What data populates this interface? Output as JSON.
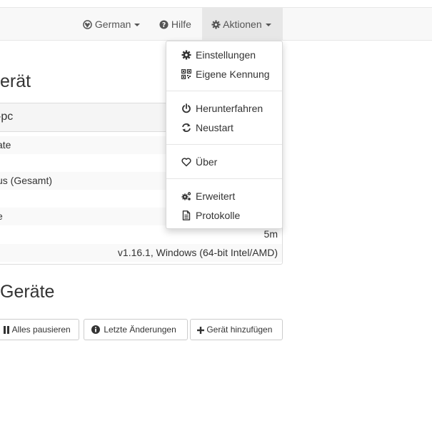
{
  "navbar": {
    "language": "German",
    "help": "Hilfe",
    "actions": "Aktionen"
  },
  "actions_menu": {
    "settings": "Einstellungen",
    "own_id": "Eigene Kennung",
    "shutdown": "Herunterfahren",
    "restart": "Neustart",
    "about": "Über",
    "advanced": "Erweitert",
    "logs": "Protokolle"
  },
  "this_device": {
    "heading": "erät",
    "name": "-pc",
    "rows": [
      {
        "label": "ate",
        "value": ""
      },
      {
        "label": "",
        "value": ""
      },
      {
        "label": "us (Gesamt)",
        "value": ""
      },
      {
        "label": "",
        "value": ""
      },
      {
        "label": "e",
        "value": ""
      },
      {
        "label": "",
        "value": "5m"
      },
      {
        "label": "",
        "value": "v1.16.1, Windows (64-bit Intel/AMD)"
      }
    ]
  },
  "remote_devices": {
    "heading": "Geräte",
    "pause_all": "Alles pausieren",
    "recent_changes": "Letzte Änderungen",
    "add_device": "Gerät hinzufügen"
  }
}
